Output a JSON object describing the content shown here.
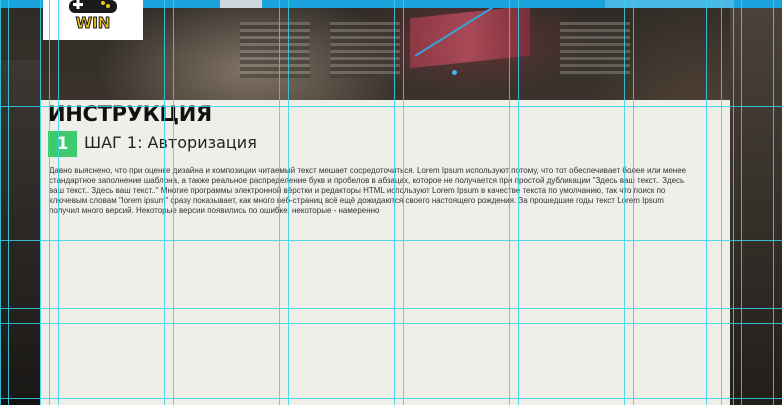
{
  "logo": {
    "text": "WIN"
  },
  "page": {
    "title": "ИНСТРУКЦИЯ",
    "step": {
      "number": "1",
      "title": "ШАГ 1: Авторизация"
    },
    "body": "Давно выяснено, что при оценке дизайна и композиции читаемый текст мешает сосредоточиться. Lorem Ipsum используют потому, что тот обеспечивает более или менее стандартное заполнение шаблона, а также реальное распределение букв и пробелов в абзацах, которое не получается при простой дубликации \"Здесь ваш текст.. Здесь ваш текст.. Здесь ваш текст..\" Многие программы электронной вёрстки и редакторы HTML используют Lorem Ipsum в качестве текста по умолчанию, так что поиск по ключевым словам \"lorem ipsum\" сразу показывает, как много веб-страниц всё ещё дожидаются своего настоящего рождения. За прошедшие годы текст Lorem Ipsum получил много версий. Некоторые версии появились по ошибке, некоторые - намеренно"
  },
  "colors": {
    "topbar": "#1aa3dc",
    "step_badge": "#3ecb6d",
    "guides": "#31d3e8"
  }
}
